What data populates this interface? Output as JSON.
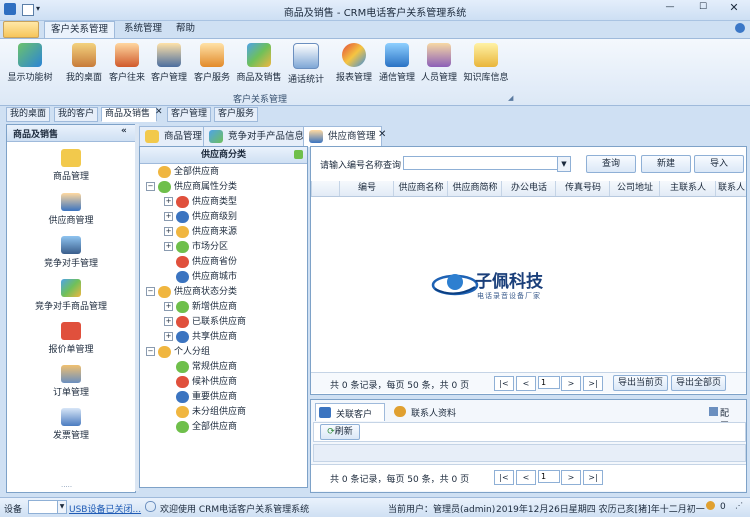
{
  "window": {
    "title": "商品及销售 - CRM电话客户关系管理系统"
  },
  "ribbon_tabs": [
    "客户关系管理",
    "系统管理",
    "帮助"
  ],
  "ribbon": {
    "buttons": [
      {
        "label": "显示功能树",
        "icon": "tree-icon"
      },
      {
        "label": "我的桌面",
        "icon": "home-icon"
      },
      {
        "label": "客户往来",
        "icon": "users-icon"
      },
      {
        "label": "客户管理",
        "icon": "customer-icon"
      },
      {
        "label": "客户服务",
        "icon": "service-icon"
      },
      {
        "label": "商品及销售",
        "icon": "products-icon"
      },
      {
        "label": "通话统计",
        "icon": "stats-icon"
      },
      {
        "label": "报表管理",
        "icon": "report-icon"
      },
      {
        "label": "通信管理",
        "icon": "comm-icon"
      },
      {
        "label": "人员管理",
        "icon": "staff-icon"
      },
      {
        "label": "知识库信息",
        "icon": "knowledge-icon"
      }
    ],
    "group_label": "客户关系管理"
  },
  "doc_tabs": [
    "我的桌面",
    "我的客户",
    "商品及销售",
    "客户管理",
    "客户服务"
  ],
  "left_panel": {
    "title": "商品及销售",
    "items": [
      {
        "label": "商品管理",
        "icon": "goods-icon"
      },
      {
        "label": "供应商管理",
        "icon": "supplier-icon"
      },
      {
        "label": "竞争对手管理",
        "icon": "competitor-icon"
      },
      {
        "label": "竞争对手商品管理",
        "icon": "competitor-goods-icon"
      },
      {
        "label": "报价单管理",
        "icon": "quote-icon"
      },
      {
        "label": "订单管理",
        "icon": "order-icon"
      },
      {
        "label": "发票管理",
        "icon": "invoice-icon"
      }
    ]
  },
  "page_tabs": [
    "商品管理",
    "竞争对手产品信息",
    "供应商管理"
  ],
  "tree": {
    "title": "供应商分类",
    "nodes": [
      {
        "label": "全部供应商",
        "level": 0,
        "exp": ""
      },
      {
        "label": "供应商属性分类",
        "level": 0,
        "exp": "−"
      },
      {
        "label": "供应商类型",
        "level": 1,
        "exp": "+"
      },
      {
        "label": "供应商级别",
        "level": 1,
        "exp": "+"
      },
      {
        "label": "供应商来源",
        "level": 1,
        "exp": "+"
      },
      {
        "label": "市场分区",
        "level": 1,
        "exp": "+"
      },
      {
        "label": "供应商省份",
        "level": 1,
        "exp": ""
      },
      {
        "label": "供应商城市",
        "level": 1,
        "exp": ""
      },
      {
        "label": "供应商状态分类",
        "level": 0,
        "exp": "−"
      },
      {
        "label": "新增供应商",
        "level": 1,
        "exp": "+"
      },
      {
        "label": "已联系供应商",
        "level": 1,
        "exp": "+"
      },
      {
        "label": "共享供应商",
        "level": 1,
        "exp": "+"
      },
      {
        "label": "个人分组",
        "level": 0,
        "exp": "−"
      },
      {
        "label": "常规供应商",
        "level": 1,
        "exp": ""
      },
      {
        "label": "候补供应商",
        "level": 1,
        "exp": ""
      },
      {
        "label": "重要供应商",
        "level": 1,
        "exp": ""
      },
      {
        "label": "未分组供应商",
        "level": 1,
        "exp": ""
      },
      {
        "label": "全部供应商",
        "level": 1,
        "exp": ""
      }
    ]
  },
  "main": {
    "search_label": "请输入编号名称查询",
    "search_value": "",
    "buttons": {
      "query": "查询",
      "new": "新建",
      "import": "导入"
    },
    "columns": [
      "编号",
      "供应商名称",
      "供应商简称",
      "办公电话",
      "传真号码",
      "公司地址",
      "主联系人",
      "联系人"
    ],
    "logo": {
      "name": "子佩科技",
      "sub": "电话录音设备厂家"
    },
    "pager": {
      "text": "共 0 条记录，每页 50 条，共 0 页",
      "page": "1",
      "first": "|<",
      "prev": "<",
      "next": ">",
      "last": ">|",
      "export_page": "导出当前页",
      "export_all": "导出全部页"
    }
  },
  "lower": {
    "tabs": [
      "关联客户",
      "联系人资料"
    ],
    "config": "配置",
    "refresh": "刷新",
    "pager": {
      "text": "共 0 条记录，每页 50 条，共 0 页",
      "page": "1",
      "first": "|<",
      "prev": "<",
      "next": ">",
      "last": ">|"
    }
  },
  "status": {
    "device_label": "设备",
    "usb": "USB设备已关闭...",
    "welcome": "欢迎使用 CRM电话客户关系管理系统",
    "user": "当前用户：管理员(admin)",
    "date": "2019年12月26日星期四 农历己亥[猪]年十二月初一",
    "count": "0"
  }
}
